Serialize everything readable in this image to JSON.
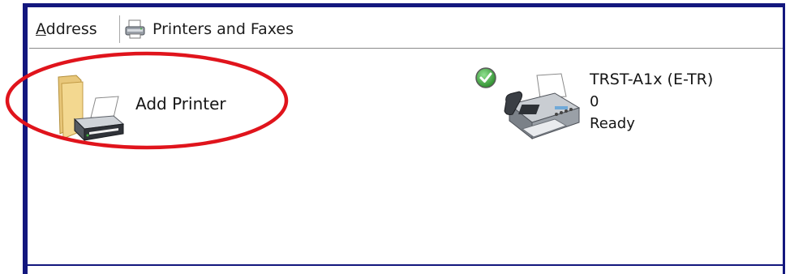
{
  "address_bar": {
    "label": "Address",
    "path": "Printers and Faxes",
    "path_icon": "printer-small-icon"
  },
  "items": {
    "add_printer": {
      "label": "Add Printer",
      "icon": "add-printer-icon"
    },
    "fax": {
      "name": "TRST-A1x (E-TR)",
      "documents": "0",
      "status": "Ready",
      "icon": "fax-machine-icon",
      "default_badge": "default-check-icon"
    }
  },
  "colors": {
    "frame": "#13177e",
    "highlight": "#e0141c",
    "check": "#3da53d"
  }
}
